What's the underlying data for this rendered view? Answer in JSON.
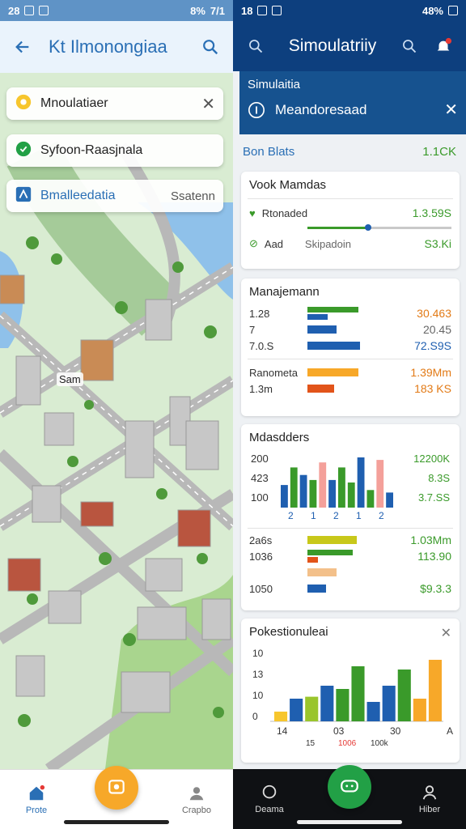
{
  "left": {
    "status": {
      "left": "28",
      "right": "8%",
      "right2": "7/1"
    },
    "app_title": "Kt Ilmonongiaa",
    "cards": [
      {
        "label": "Mnoulatiaer",
        "has_close": true
      },
      {
        "label": "Syfoon-Raasjnala"
      },
      {
        "label": "Bmalleedatia",
        "sub": "Ssatenn"
      }
    ],
    "map_label": "Sam",
    "nav": {
      "left": "Prote",
      "right": "Crapbo"
    }
  },
  "right": {
    "status": {
      "time": "18",
      "battery": "48%"
    },
    "app_title": "Simoulatriiy",
    "banner": {
      "title": "Simulaitia",
      "text": "Meandoresaad"
    },
    "summary": {
      "key": "Bon Blats",
      "value": "1.1CK"
    },
    "card1": {
      "title": "Vook Mamdas",
      "row1": {
        "label": "Rtonaded",
        "value": "1.3.59S",
        "bar": 0.42
      },
      "row2": {
        "label": "Aad",
        "mid": "Skipadoin",
        "value": "S3.Ki"
      }
    },
    "card2": {
      "title": "Manajemann",
      "rows": [
        {
          "label": "1.28",
          "bars": [
            {
              "c": "#3a9a2a",
              "v": 0.95
            },
            {
              "c": "#1f5fb0",
              "v": 0.38
            }
          ],
          "value": "30.463",
          "vcolor": "orange"
        },
        {
          "label": "7",
          "bars": [
            {
              "c": "#1f5fb0",
              "v": 0.55
            }
          ],
          "value": "20.45",
          "vcolor": "grey"
        },
        {
          "label": "7.0.S",
          "bars": [
            {
              "c": "#1f5fb0",
              "v": 0.98
            }
          ],
          "value": "72.S9S",
          "vcolor": "blue"
        }
      ],
      "rows2": [
        {
          "label": "Ranometa",
          "bars": [
            {
              "c": "#f7a829",
              "v": 0.95
            }
          ],
          "value": "1.39Mm",
          "vcolor": "orange"
        },
        {
          "label": "1.3m",
          "bars": [
            {
              "c": "#e2541a",
              "v": 0.5
            }
          ],
          "value": "183 KS",
          "vcolor": "orange"
        }
      ]
    },
    "card3": {
      "title": "Mdasdders",
      "y_ticks": [
        "200",
        "423",
        "100"
      ],
      "x_ticks": [
        "2",
        "1",
        "2",
        "1",
        "2"
      ],
      "values": [
        {
          "v": 0.45,
          "c": "#1f5fb0"
        },
        {
          "v": 0.8,
          "c": "#3a9a2a"
        },
        {
          "v": 0.65,
          "c": "#1f5fb0"
        },
        {
          "v": 0.55,
          "c": "#3a9a2a"
        },
        {
          "v": 0.9,
          "c": "#f4a09a"
        },
        {
          "v": 0.55,
          "c": "#1f5fb0"
        },
        {
          "v": 0.8,
          "c": "#3a9a2a"
        },
        {
          "v": 0.5,
          "c": "#3a9a2a"
        },
        {
          "v": 1.0,
          "c": "#1f5fb0"
        },
        {
          "v": 0.35,
          "c": "#3a9a2a"
        },
        {
          "v": 0.95,
          "c": "#f4a09a"
        },
        {
          "v": 0.3,
          "c": "#1f5fb0"
        }
      ],
      "right_vals": [
        "12200K",
        "8.3S",
        "3.7.SS"
      ],
      "rows": [
        {
          "label": "2a6s",
          "bars": [
            {
              "c": "#c8c81a",
              "v": 0.92
            }
          ],
          "value": "1.03Mm",
          "vcolor": "green"
        },
        {
          "label": "1036",
          "bars": [
            {
              "c": "#3a9a2a",
              "v": 0.85
            },
            {
              "c": "#e2541a",
              "v": 0.2
            }
          ],
          "value": "113.90",
          "vcolor": "green"
        },
        {
          "label": "",
          "bars": [
            {
              "c": "#f3c08a",
              "v": 0.55
            }
          ],
          "value": "",
          "vcolor": "green"
        },
        {
          "label": "1050",
          "bars": [
            {
              "c": "#1f5fb0",
              "v": 0.35
            }
          ],
          "value": "$9.3.3",
          "vcolor": "green"
        }
      ]
    },
    "card4": {
      "title": "Pokestionuleai",
      "y_ticks": [
        "10",
        "13",
        "10",
        "0"
      ],
      "x_ticks": [
        "14",
        "03",
        "30",
        "A"
      ],
      "x_sub": [
        "15",
        "1006",
        "100k"
      ],
      "values": [
        {
          "v": 0.15,
          "c": "#f7c62d"
        },
        {
          "v": 0.35,
          "c": "#1f5fb0"
        },
        {
          "v": 0.38,
          "c": "#9ac52c"
        },
        {
          "v": 0.55,
          "c": "#1f5fb0"
        },
        {
          "v": 0.5,
          "c": "#3a9a2a"
        },
        {
          "v": 0.85,
          "c": "#3a9a2a"
        },
        {
          "v": 0.3,
          "c": "#1f5fb0"
        },
        {
          "v": 0.55,
          "c": "#1f5fb0"
        },
        {
          "v": 0.8,
          "c": "#3a9a2a"
        },
        {
          "v": 0.35,
          "c": "#f7a829"
        },
        {
          "v": 0.95,
          "c": "#f7a829"
        }
      ]
    },
    "nav": {
      "left": "Deama",
      "right": "Hiber"
    }
  }
}
